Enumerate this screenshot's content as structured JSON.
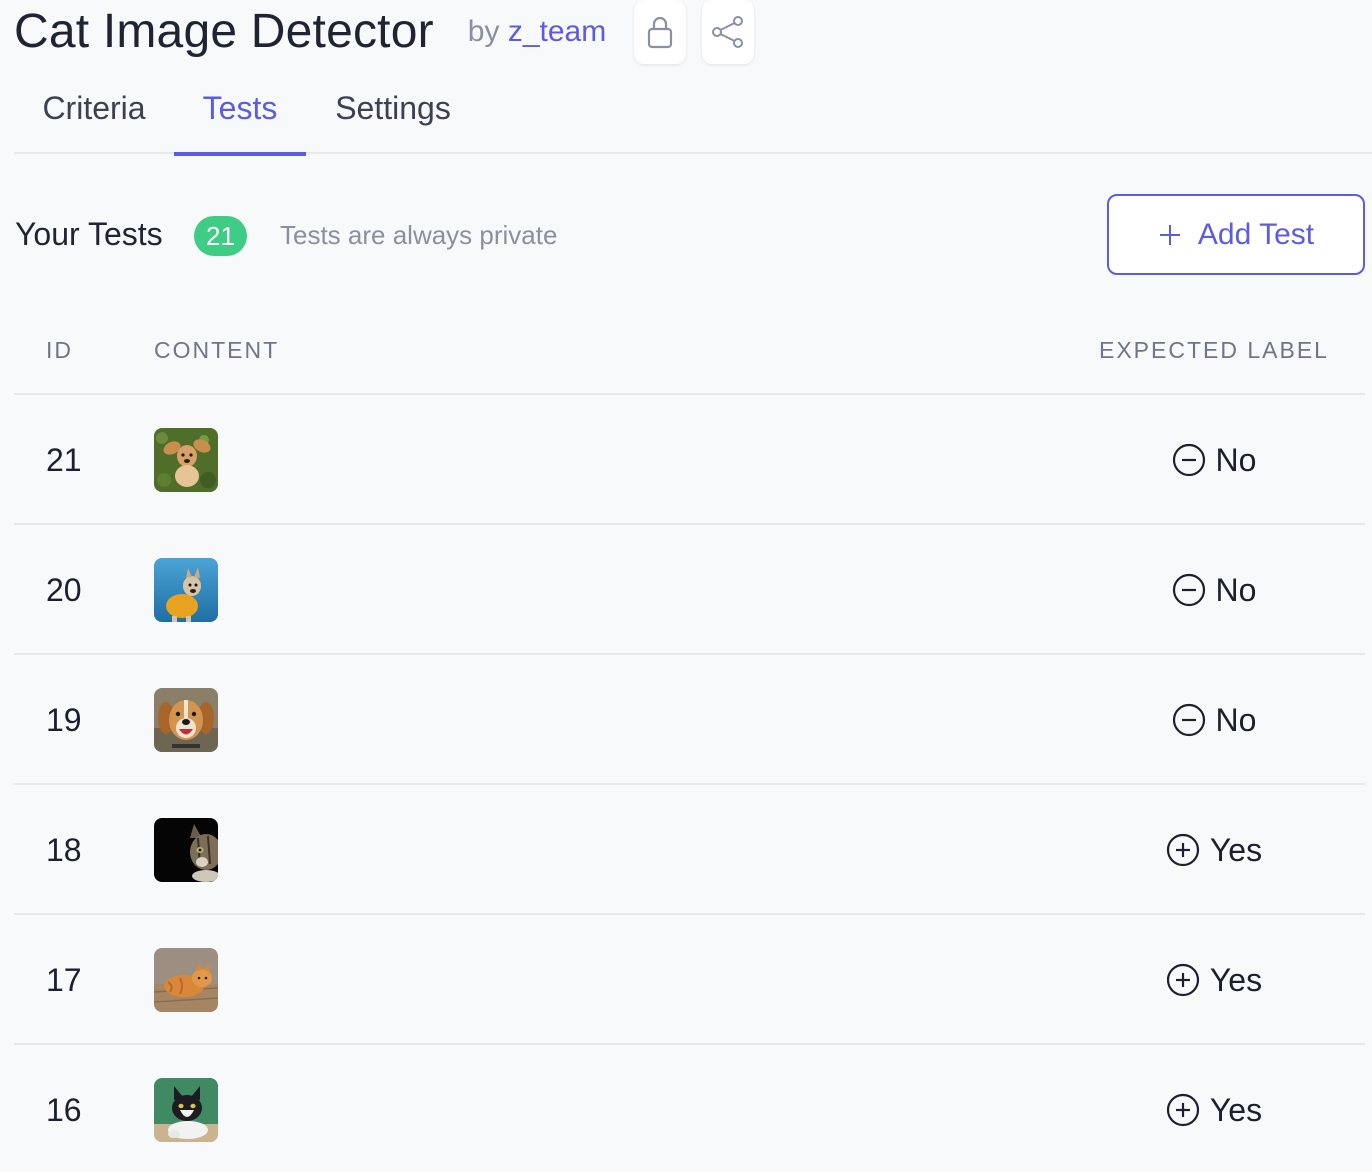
{
  "header": {
    "title": "Cat Image Detector",
    "by_prefix": "by",
    "team": "z_team",
    "icons": [
      "lock-icon",
      "share-icon"
    ]
  },
  "tabs": [
    {
      "label": "Criteria",
      "active": false
    },
    {
      "label": "Tests",
      "active": true
    },
    {
      "label": "Settings",
      "active": false
    }
  ],
  "tests": {
    "title": "Your Tests",
    "count": "21",
    "note": "Tests are always private",
    "add_label": "Add Test",
    "columns": {
      "id": "ID",
      "content": "CONTENT",
      "expected": "EXPECTED LABEL"
    },
    "rows": [
      {
        "id": "21",
        "thumbnail": "dog-on-grass",
        "label": "No",
        "icon": "minus-circle-icon"
      },
      {
        "id": "20",
        "thumbnail": "dog-yellow-vest",
        "label": "No",
        "icon": "minus-circle-icon"
      },
      {
        "id": "19",
        "thumbnail": "smiling-dog",
        "label": "No",
        "icon": "minus-circle-icon"
      },
      {
        "id": "18",
        "thumbnail": "tabby-cat-dark",
        "label": "Yes",
        "icon": "plus-circle-icon"
      },
      {
        "id": "17",
        "thumbnail": "orange-cat-lying",
        "label": "Yes",
        "icon": "plus-circle-icon"
      },
      {
        "id": "16",
        "thumbnail": "tuxedo-cat",
        "label": "Yes",
        "icon": "plus-circle-icon"
      }
    ]
  },
  "colors": {
    "accent": "#5b5ce2",
    "badge": "#3fcc84",
    "background": "#f8f9fb",
    "muted": "#8a90a0"
  }
}
